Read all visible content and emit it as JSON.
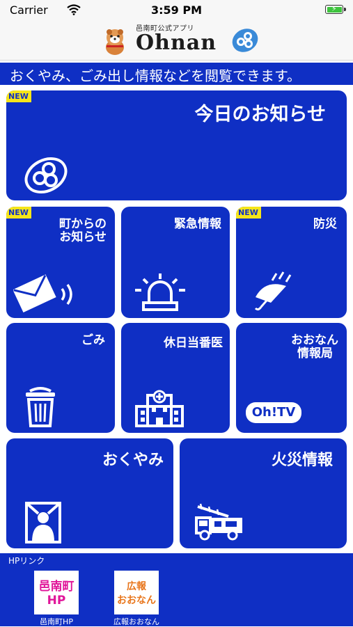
{
  "status_bar": {
    "carrier": "Carrier",
    "time": "3:59 PM"
  },
  "header": {
    "subtitle": "邑南町公式アプリ",
    "title": "Ohnan"
  },
  "banner": {
    "text": "おくやみ、ごみ出し情報などを閲覧できます。"
  },
  "tiles": [
    {
      "label": "今日のお知らせ",
      "new": "NEW",
      "icon": "ohnan-logo-icon"
    },
    {
      "label_line1": "町からの",
      "label_line2": "お知らせ",
      "new": "NEW",
      "icon": "envelope-signal-icon"
    },
    {
      "label": "緊急情報",
      "icon": "siren-icon"
    },
    {
      "label": "防災",
      "new": "NEW",
      "icon": "umbrella-rain-icon"
    },
    {
      "label": "ごみ",
      "icon": "trash-can-icon"
    },
    {
      "label": "休日当番医",
      "icon": "hospital-icon"
    },
    {
      "label_line1": "おおなん",
      "label_line2": "情報局",
      "icon": "ohtv-icon",
      "icon_text": "Oh!TV"
    },
    {
      "label": "おくやみ",
      "icon": "memorial-frame-icon"
    },
    {
      "label": "火災情報",
      "icon": "fire-truck-icon"
    }
  ],
  "hp_links": {
    "title": "HPリンク",
    "items": [
      {
        "line1": "邑南町",
        "line2": "HP",
        "caption": "邑南町HP",
        "color": "#e0169a"
      },
      {
        "line1": "広報",
        "line2": "おおなん",
        "caption": "広報おおなん",
        "color": "#e8751a"
      }
    ]
  },
  "colors": {
    "tile_blue": "#0f2fc4",
    "badge_yellow": "#f5e51a",
    "battery_green": "#3ec43e"
  }
}
